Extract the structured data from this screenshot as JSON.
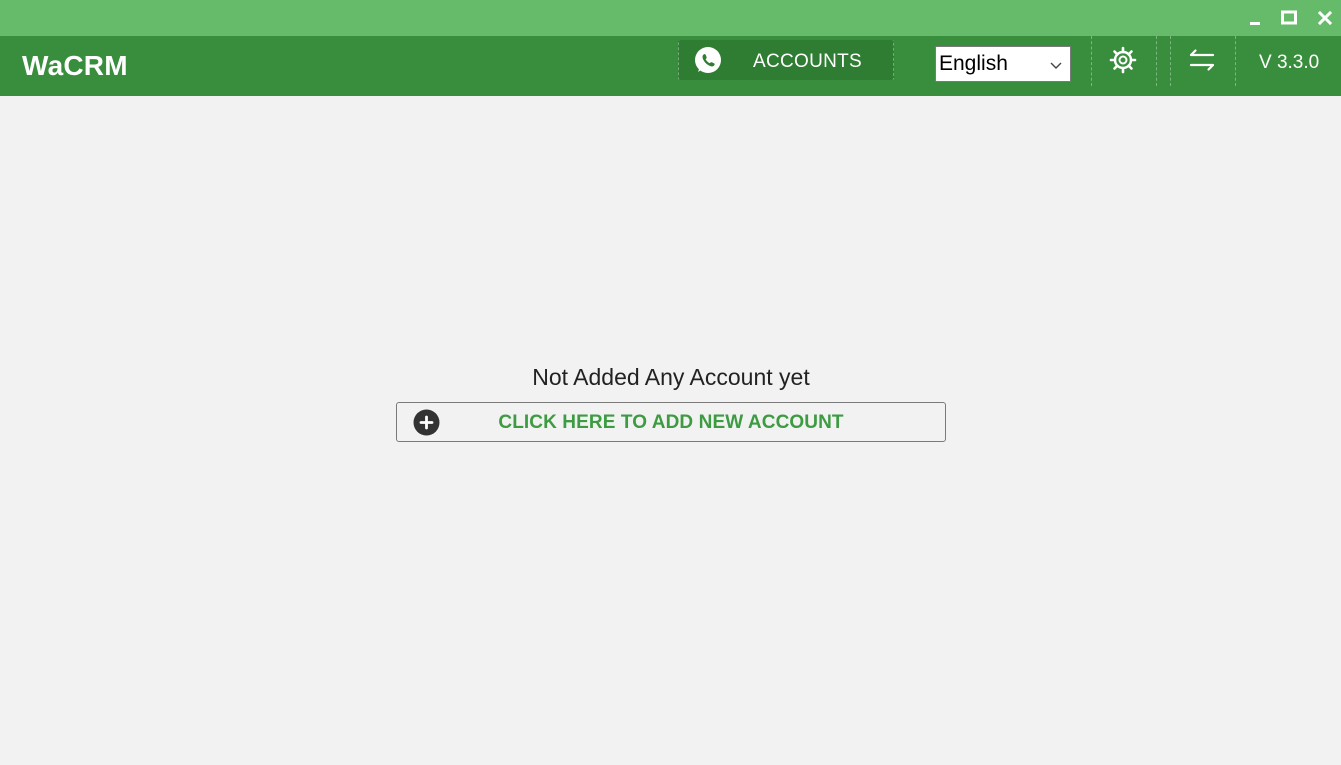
{
  "app": {
    "title": "WaCRM",
    "version": "V 3.3.0"
  },
  "window_controls": {
    "minimize_icon": "minimize-icon",
    "maximize_icon": "maximize-icon",
    "close_icon": "close-icon"
  },
  "header": {
    "accounts_button": {
      "label": "ACCOUNTS",
      "icon": "whatsapp-icon"
    },
    "language_select": {
      "value": "English"
    },
    "settings_icon": "gear-icon",
    "sync_icon": "swap-arrows-icon"
  },
  "main": {
    "empty_message": "Not Added Any Account yet",
    "add_account_button": {
      "label": "CLICK HERE TO ADD NEW ACCOUNT",
      "icon": "plus-circle-icon"
    }
  },
  "colors": {
    "titlebar": "#66bb6a",
    "header": "#388e3c",
    "accounts_button_bg": "#2e7d32",
    "page_bg": "#f2f2f2",
    "accent_text": "#3d9b42"
  }
}
